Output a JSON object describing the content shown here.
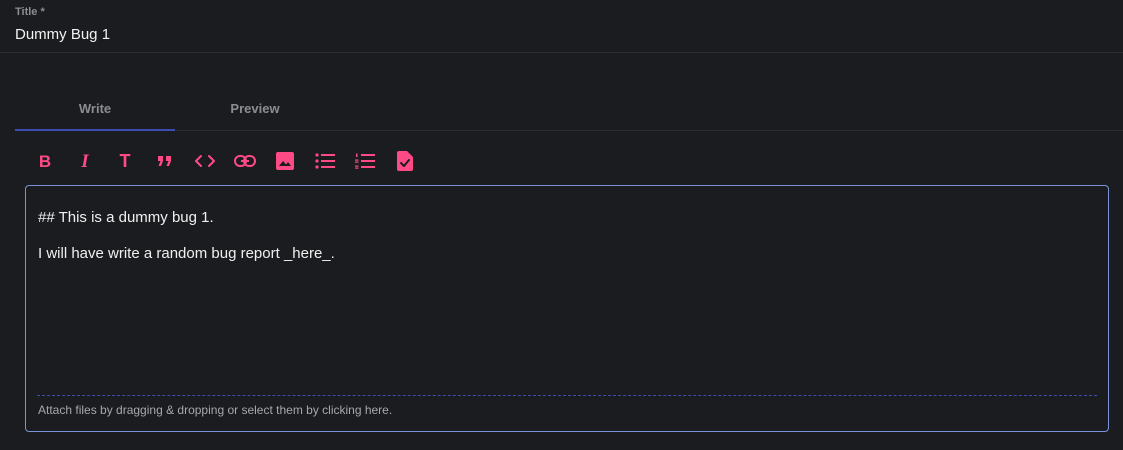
{
  "title_field": {
    "label": "Title *",
    "value": "Dummy Bug 1"
  },
  "tabs": [
    {
      "label": "Write",
      "active": true
    },
    {
      "label": "Preview",
      "active": false
    }
  ],
  "toolbar": {
    "accent_color": "#ff4a86",
    "tools": [
      {
        "icon": "bold-icon",
        "glyph": "B"
      },
      {
        "icon": "italic-icon",
        "glyph": "I"
      },
      {
        "icon": "header-icon",
        "glyph": "T"
      },
      {
        "icon": "quote-icon"
      },
      {
        "icon": "code-icon"
      },
      {
        "icon": "link-icon"
      },
      {
        "icon": "image-icon"
      },
      {
        "icon": "bullet-list-icon"
      },
      {
        "icon": "numbered-list-icon"
      },
      {
        "icon": "task-list-icon"
      }
    ]
  },
  "editor": {
    "lines": [
      "## This is a dummy bug 1.",
      "I will have write a random bug report _here_."
    ],
    "attach_hint": "Attach files by dragging & dropping or select them by clicking here.",
    "border_color": "#7a93d8",
    "divider_color": "#3c4fb0"
  }
}
